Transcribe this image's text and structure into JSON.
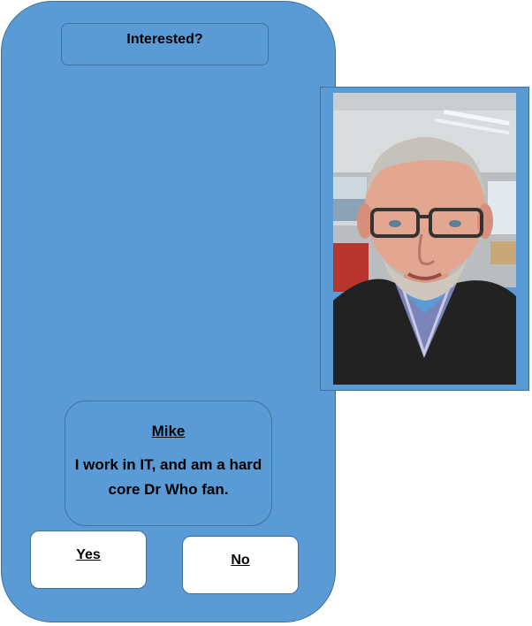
{
  "header": {
    "title": "Interested?"
  },
  "profile": {
    "name": "Mike",
    "bio": "I work in IT, and am a hard core Dr Who fan."
  },
  "actions": {
    "yes_label": "Yes",
    "no_label": "No"
  },
  "colors": {
    "panel": "#5b9bd5",
    "border": "#41719c",
    "button_bg": "#ffffff"
  }
}
